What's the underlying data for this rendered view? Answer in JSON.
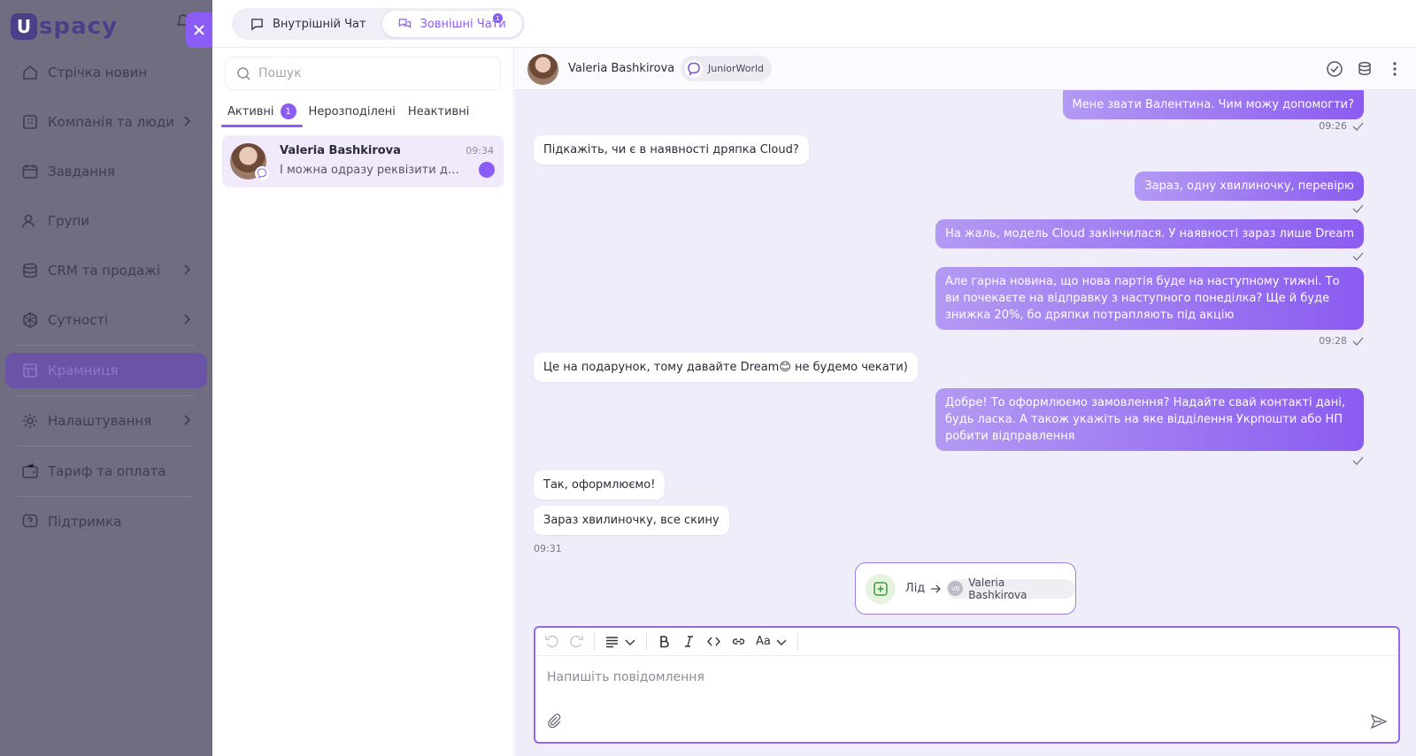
{
  "app": {
    "logo_letter": "U",
    "logo_text": "spacy"
  },
  "sidebar": {
    "items": [
      {
        "label": "Стрічка новин"
      },
      {
        "label": "Компанія та люди"
      },
      {
        "label": "Завдання"
      },
      {
        "label": "Групи"
      },
      {
        "label": "CRM та продажі"
      },
      {
        "label": "Сутності"
      },
      {
        "label": "Крамниця"
      },
      {
        "label": "Налаштування"
      },
      {
        "label": "Тариф та оплата"
      },
      {
        "label": "Підтримка"
      }
    ]
  },
  "top_tabs": [
    {
      "label": "Внутрішній Чат"
    },
    {
      "label": "Зовнішні Чати",
      "badge": "1"
    }
  ],
  "chat_list": {
    "search_placeholder": "Пошук",
    "tabs": [
      {
        "label": "Активні",
        "count": "1"
      },
      {
        "label": "Нерозподілені"
      },
      {
        "label": "Неактивні"
      }
    ],
    "items": [
      {
        "name": "Valeria Bashkirova",
        "time": "09:34",
        "preview": "І можна одразу реквізити для оплати"
      }
    ]
  },
  "chat": {
    "contact_name": "Valeria Bashkirova",
    "source": "JuniorWorld",
    "messages": [
      {
        "text": "Мене звати Валентина. Чим можу допомогти?"
      },
      {
        "text": "Підкажіть, чи є в наявності дряпка Cloud?"
      },
      {
        "text": "Зараз, одну хвилиночку, перевірю"
      },
      {
        "text": "На жаль, модель Cloud закінчилася. У наявності зараз лише Dream"
      },
      {
        "text": "Але гарна новина, що нова партія буде на наступному тижні. То ви почекаєте на відправку з наступного понеділка? Ще й буде знижка 20%, бо дряпки потрапляють під акцію"
      },
      {
        "text": "Це на подарунок, тому давайте Dream😊 не будемо чекати)"
      },
      {
        "text": "Добре! То оформлюємо замовлення? Надайте свай контакті дані, будь ласка. А також укажіть на яке відділення Укрпошти або НП робити відправлення"
      },
      {
        "text": "Так, оформлюємо!"
      },
      {
        "text": "Зараз хвилиночку, все скину"
      }
    ],
    "times": {
      "t1": "09:26",
      "t2": "09:28",
      "t3": "09:31"
    },
    "lead_card": {
      "label": "Лід",
      "initials": "VB",
      "person": "Valeria Bashkirova"
    },
    "composer": {
      "placeholder": "Напишіть повідомлення",
      "font_label": "Aa"
    }
  },
  "colors": {
    "accent": "#8b5cf6",
    "sidebar_overlay": "#716d80",
    "chat_bg": "#efedf9"
  }
}
